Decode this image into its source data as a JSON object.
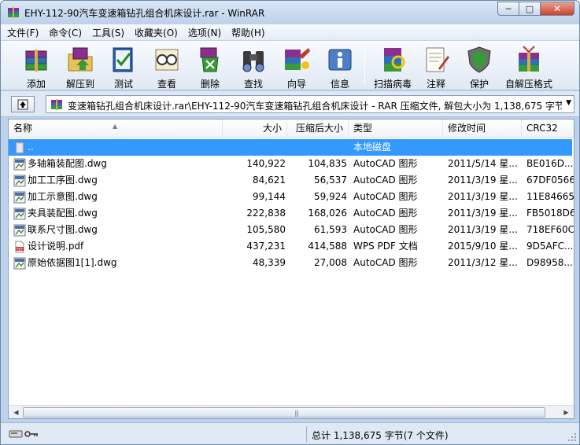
{
  "window": {
    "title": "EHY-112-90汽车变速箱钻孔组合机床设计.rar - WinRAR",
    "controls": {
      "minimize": "─",
      "maximize": "□",
      "close": "✕"
    }
  },
  "menu": [
    "文件(F)",
    "命令(C)",
    "工具(S)",
    "收藏夹(O)",
    "选项(N)",
    "帮助(H)"
  ],
  "toolbar": [
    {
      "label": "添加",
      "icon": "add-archive-icon"
    },
    {
      "label": "解压到",
      "icon": "extract-to-icon"
    },
    {
      "label": "测试",
      "icon": "test-icon"
    },
    {
      "label": "查看",
      "icon": "view-icon"
    },
    {
      "label": "删除",
      "icon": "delete-icon"
    },
    {
      "label": "查找",
      "icon": "find-binoculars-icon"
    },
    {
      "label": "向导",
      "icon": "wizard-icon"
    },
    {
      "label": "信息",
      "icon": "info-icon"
    },
    {
      "label": "扫描病毒",
      "icon": "virus-scan-icon"
    },
    {
      "label": "注释",
      "icon": "comment-icon"
    },
    {
      "label": "保护",
      "icon": "protect-shield-icon"
    },
    {
      "label": "自解压格式",
      "icon": "sfx-icon"
    }
  ],
  "address": {
    "up_label": "↑",
    "path": "变速箱钻孔组合机床设计.rar\\EHY-112-90汽车变速箱钻孔组合机床设计 - RAR 压缩文件, 解包大小为 1,138,675 字节"
  },
  "columns": {
    "name": "名称",
    "size": "大小",
    "packed": "压缩后大小",
    "type": "类型",
    "modified": "修改时间",
    "crc": "CRC32"
  },
  "files": [
    {
      "name": "..",
      "size": "",
      "packed": "",
      "type": "本地磁盘",
      "modified": "",
      "crc": "",
      "kind": "parent",
      "selected": true
    },
    {
      "name": "多轴箱装配图.dwg",
      "size": "140,922",
      "packed": "104,835",
      "type": "AutoCAD 图形",
      "modified": "2011/5/14 星...",
      "crc": "BE016D...",
      "kind": "dwg"
    },
    {
      "name": "加工工序图.dwg",
      "size": "84,621",
      "packed": "56,537",
      "type": "AutoCAD 图形",
      "modified": "2011/3/19 星...",
      "crc": "67DF0566",
      "kind": "dwg"
    },
    {
      "name": "加工示意图.dwg",
      "size": "99,144",
      "packed": "59,924",
      "type": "AutoCAD 图形",
      "modified": "2011/3/19 星...",
      "crc": "11E84665",
      "kind": "dwg"
    },
    {
      "name": "夹具装配图.dwg",
      "size": "222,838",
      "packed": "168,026",
      "type": "AutoCAD 图形",
      "modified": "2011/3/19 星...",
      "crc": "FB5018D6",
      "kind": "dwg"
    },
    {
      "name": "联系尺寸图.dwg",
      "size": "105,580",
      "packed": "61,593",
      "type": "AutoCAD 图形",
      "modified": "2011/3/19 星...",
      "crc": "718EF60C",
      "kind": "dwg"
    },
    {
      "name": "设计说明.pdf",
      "size": "437,231",
      "packed": "414,588",
      "type": "WPS PDF 文档",
      "modified": "2015/9/10 星...",
      "crc": "9D5AFC...",
      "kind": "pdf"
    },
    {
      "name": "原始依据图1[1].dwg",
      "size": "48,339",
      "packed": "27,008",
      "type": "AutoCAD 图形",
      "modified": "2011/3/12 星...",
      "crc": "D98958...",
      "kind": "dwg"
    }
  ],
  "status": {
    "summary": "总计 1,138,675 字节(7 个文件)"
  },
  "colors": {
    "selection": "#3399ff",
    "window_frame": "#bcd1ea"
  }
}
